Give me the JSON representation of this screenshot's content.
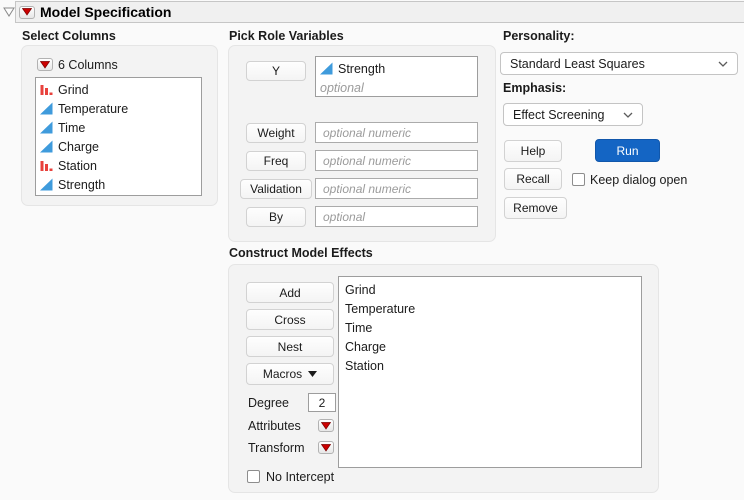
{
  "header": {
    "title": "Model Specification"
  },
  "select_columns": {
    "label": "Select Columns",
    "count_label": "6 Columns",
    "columns": [
      {
        "name": "Grind",
        "type": "nominal"
      },
      {
        "name": "Temperature",
        "type": "continuous"
      },
      {
        "name": "Time",
        "type": "continuous"
      },
      {
        "name": "Charge",
        "type": "continuous"
      },
      {
        "name": "Station",
        "type": "nominal"
      },
      {
        "name": "Strength",
        "type": "continuous"
      }
    ]
  },
  "pick_roles": {
    "label": "Pick Role Variables",
    "y": {
      "button": "Y",
      "items": [
        {
          "name": "Strength",
          "type": "continuous"
        }
      ],
      "placeholder": "optional"
    },
    "roles": [
      {
        "button": "Weight",
        "placeholder": "optional numeric"
      },
      {
        "button": "Freq",
        "placeholder": "optional numeric"
      },
      {
        "button": "Validation",
        "placeholder": "optional numeric"
      },
      {
        "button": "By",
        "placeholder": "optional"
      }
    ]
  },
  "personality": {
    "label": "Personality:",
    "value": "Standard Least Squares"
  },
  "emphasis": {
    "label": "Emphasis:",
    "value": "Effect Screening"
  },
  "actions": {
    "help": "Help",
    "run": "Run",
    "recall": "Recall",
    "remove": "Remove",
    "keep_dialog_open": {
      "label": "Keep dialog open",
      "checked": false
    }
  },
  "model_effects": {
    "label": "Construct Model Effects",
    "buttons": [
      "Add",
      "Cross",
      "Nest"
    ],
    "macros_label": "Macros",
    "degree": {
      "label": "Degree",
      "value": "2"
    },
    "attributes_label": "Attributes",
    "transform_label": "Transform",
    "no_intercept": {
      "label": "No Intercept",
      "checked": false
    },
    "effects": [
      "Grind",
      "Temperature",
      "Time",
      "Charge",
      "Station"
    ]
  },
  "icons": {
    "disclosure": "disclosure-triangle-down",
    "menu": "red-triangle-menu",
    "continuous": "blue-continuous-triangle",
    "nominal": "red-nominal-bars",
    "dropdown": "chevron-down"
  },
  "colors": {
    "run_blue": "#1465c4",
    "icon_red": "#e8413c",
    "icon_blue": "#3f9bdc",
    "triangle_red": "#cc0000",
    "panel_gray": "#f3f3f3"
  }
}
